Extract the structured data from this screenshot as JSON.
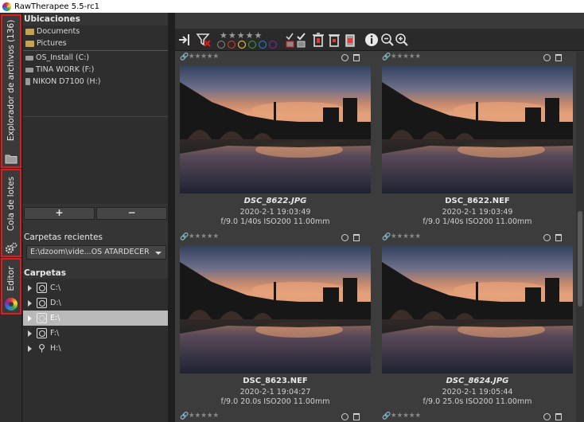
{
  "window": {
    "title": "RawTherapee 5.5-rc1"
  },
  "vertical_tabs": [
    {
      "label": "Explorador de archivos (136)"
    },
    {
      "label": "Cola de lotes"
    },
    {
      "label": "Editor"
    }
  ],
  "places": {
    "heading": "Ubicaciones",
    "items": [
      {
        "label": "Documents",
        "icon": "folder-icon"
      },
      {
        "label": "Pictures",
        "icon": "folder-icon"
      },
      {
        "label": "OS_Install (C:)",
        "icon": "drive-icon"
      },
      {
        "label": "TINA WORK (F:)",
        "icon": "drive-icon"
      },
      {
        "label": "NIKON D7100 (H:)",
        "icon": "drive-icon"
      }
    ],
    "add_label": "+",
    "remove_label": "−"
  },
  "recent": {
    "heading": "Carpetas recientes",
    "selected": "E:\\dzoom\\vide...OS ATARDECER"
  },
  "folders": {
    "heading": "Carpetas",
    "items": [
      {
        "label": "C:\\",
        "icon": "disk-icon",
        "selected": false
      },
      {
        "label": "D:\\",
        "icon": "disk-icon",
        "selected": false
      },
      {
        "label": "E:\\",
        "icon": "disk-icon",
        "selected": true
      },
      {
        "label": "F:\\",
        "icon": "disk-icon",
        "selected": false
      },
      {
        "label": "H:\\",
        "icon": "usb-icon",
        "selected": false
      }
    ]
  },
  "toolbar": {
    "stars": "★★★★★",
    "label_colors": [
      "#e53935",
      "#fdd835",
      "#43a047",
      "#1e88e5",
      "#8e24aa"
    ]
  },
  "thumbnails": [
    {
      "name": "DSC_8622.JPG",
      "date": "2020-2-1 19:03:49",
      "exif": "f/9.0 1/40s ISO200 11.00mm",
      "italic": true
    },
    {
      "name": "DSC_8622.NEF",
      "date": "2020-2-1 19:03:49",
      "exif": "f/9.0 1/40s ISO200 11.00mm",
      "italic": false
    },
    {
      "name": "DSC_8623.NEF",
      "date": "2020-2-1 19:04:27",
      "exif": "f/9.0 20.0s ISO200 11.00mm",
      "italic": false
    },
    {
      "name": "DSC_8624.JPG",
      "date": "2020-2-1 19:05:44",
      "exif": "f/9.0 25.0s ISO200 11.00mm",
      "italic": true
    }
  ],
  "colors": {
    "highlight": "#e01b1b",
    "selected_row": "#b9b9b9"
  }
}
